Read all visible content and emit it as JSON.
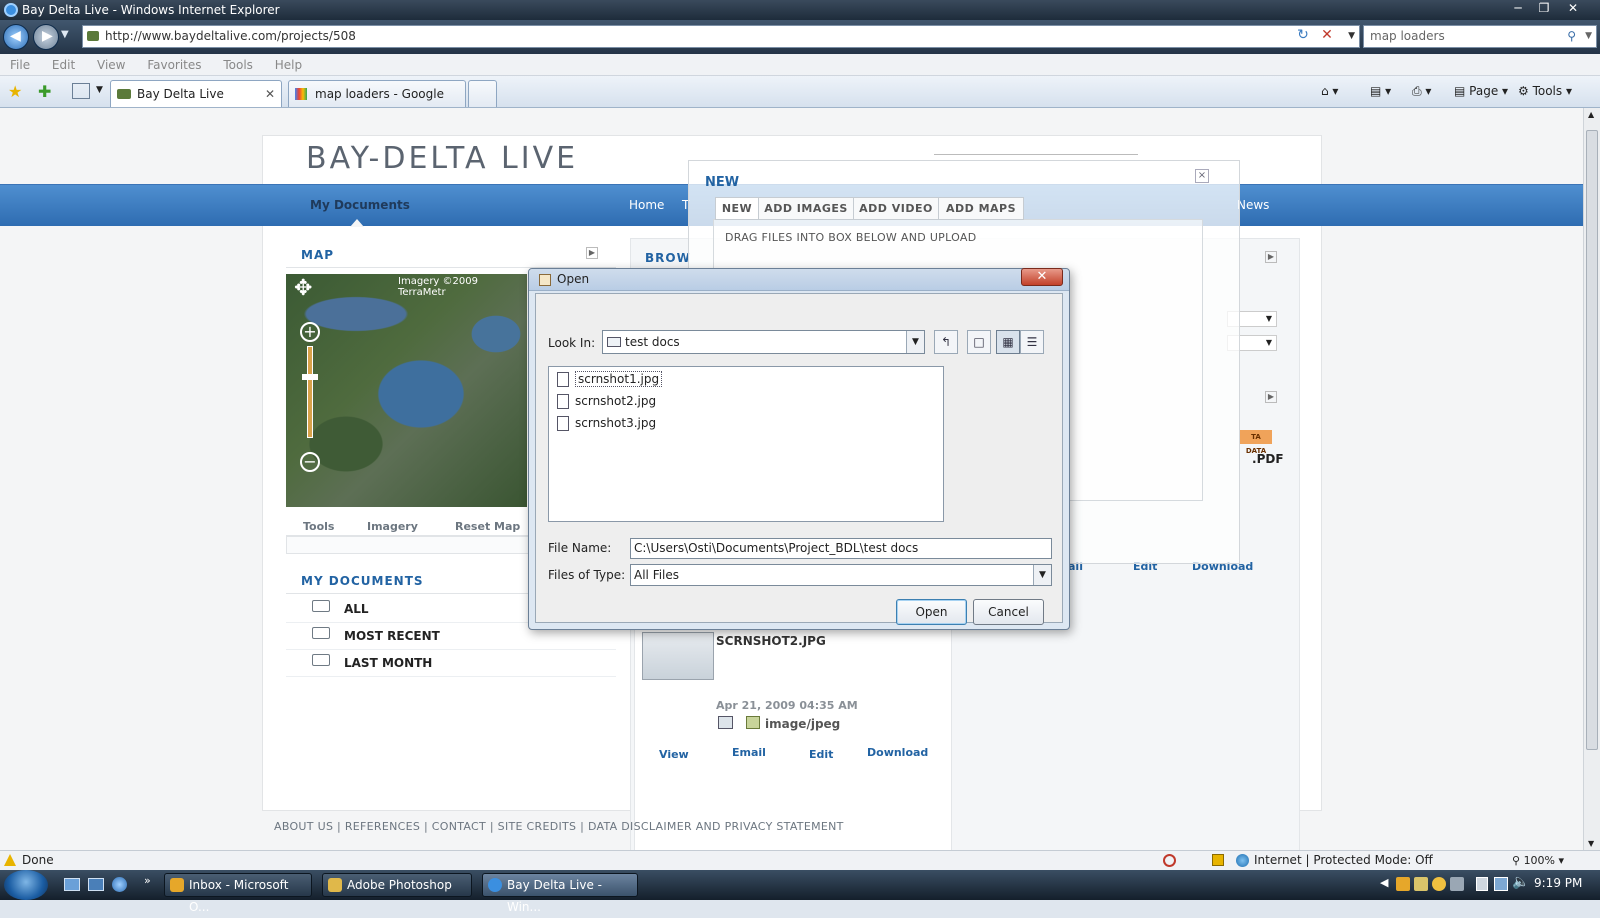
{
  "window": {
    "title": "Bay Delta Live - Windows Internet Explorer",
    "address_url": "http://www.baydeltalive.com/projects/508",
    "search_text": "map loaders",
    "menu": [
      "File",
      "Edit",
      "View",
      "Favorites",
      "Tools",
      "Help"
    ],
    "tabs": [
      {
        "label": "Bay Delta Live",
        "active": true
      },
      {
        "label": "map loaders - Google Sear...",
        "active": false
      }
    ],
    "command_bar": {
      "page": "Page",
      "tools": "Tools"
    }
  },
  "page": {
    "logo": "BAY-DELTA LIVE",
    "nav": {
      "my_documents": "My Documents",
      "home": "Home",
      "t_fragment": "T",
      "news": "News"
    },
    "map_panel": {
      "title": "MAP",
      "imagery_credit": "Imagery ©2009 TerraMetr",
      "tools": [
        "Tools",
        "Imagery",
        "Reset Map"
      ]
    },
    "browse_title": "BROW",
    "my_documents": {
      "title": "MY DOCUMENTS",
      "items": [
        "ALL",
        "MOST RECENT",
        "LAST MONTH"
      ]
    },
    "doc_card": {
      "name": "SCRNSHOT2.JPG",
      "date": "Apr 21, 2009 04:35 AM",
      "type": "image/jpeg",
      "actions": [
        "View",
        "Email",
        "Edit",
        "Download"
      ]
    },
    "right_card": {
      "badge": "TA DATA",
      "filename_fragment": "PDF",
      "actions": [
        "ail",
        "Edit",
        "Download"
      ]
    },
    "footer": [
      "ABOUT US",
      "REFERENCES",
      "CONTACT",
      "SITE CREDITS",
      "DATA DISCLAIMER AND PRIVACY STATEMENT"
    ]
  },
  "new_dialog": {
    "title": "NEW",
    "close": "×",
    "tabs": [
      "NEW",
      "ADD IMAGES",
      "ADD VIDEO",
      "ADD MAPS"
    ],
    "instruction": "DRAG FILES INTO BOX BELOW AND UPLOAD"
  },
  "open_dialog": {
    "title": "Open",
    "look_in_label": "Look In:",
    "look_in_value": "test docs",
    "files": [
      "scrnshot1.jpg",
      "scrnshot2.jpg",
      "scrnshot3.jpg"
    ],
    "file_name_label": "File Name:",
    "file_name_value": "C:\\Users\\Osti\\Documents\\Project_BDL\\test docs",
    "files_of_type_label": "Files of Type:",
    "files_of_type_value": "All Files",
    "open_button": "Open",
    "cancel_button": "Cancel"
  },
  "statusbar": {
    "status": "Done",
    "zone": "Internet | Protected Mode: Off",
    "zoom": "100%"
  },
  "taskbar": {
    "items": [
      {
        "label": "Inbox - Microsoft O...",
        "active": false
      },
      {
        "label": "Adobe Photoshop",
        "active": false
      },
      {
        "label": "Bay Delta Live - Win...",
        "active": true
      }
    ],
    "clock": "9:19 PM"
  }
}
